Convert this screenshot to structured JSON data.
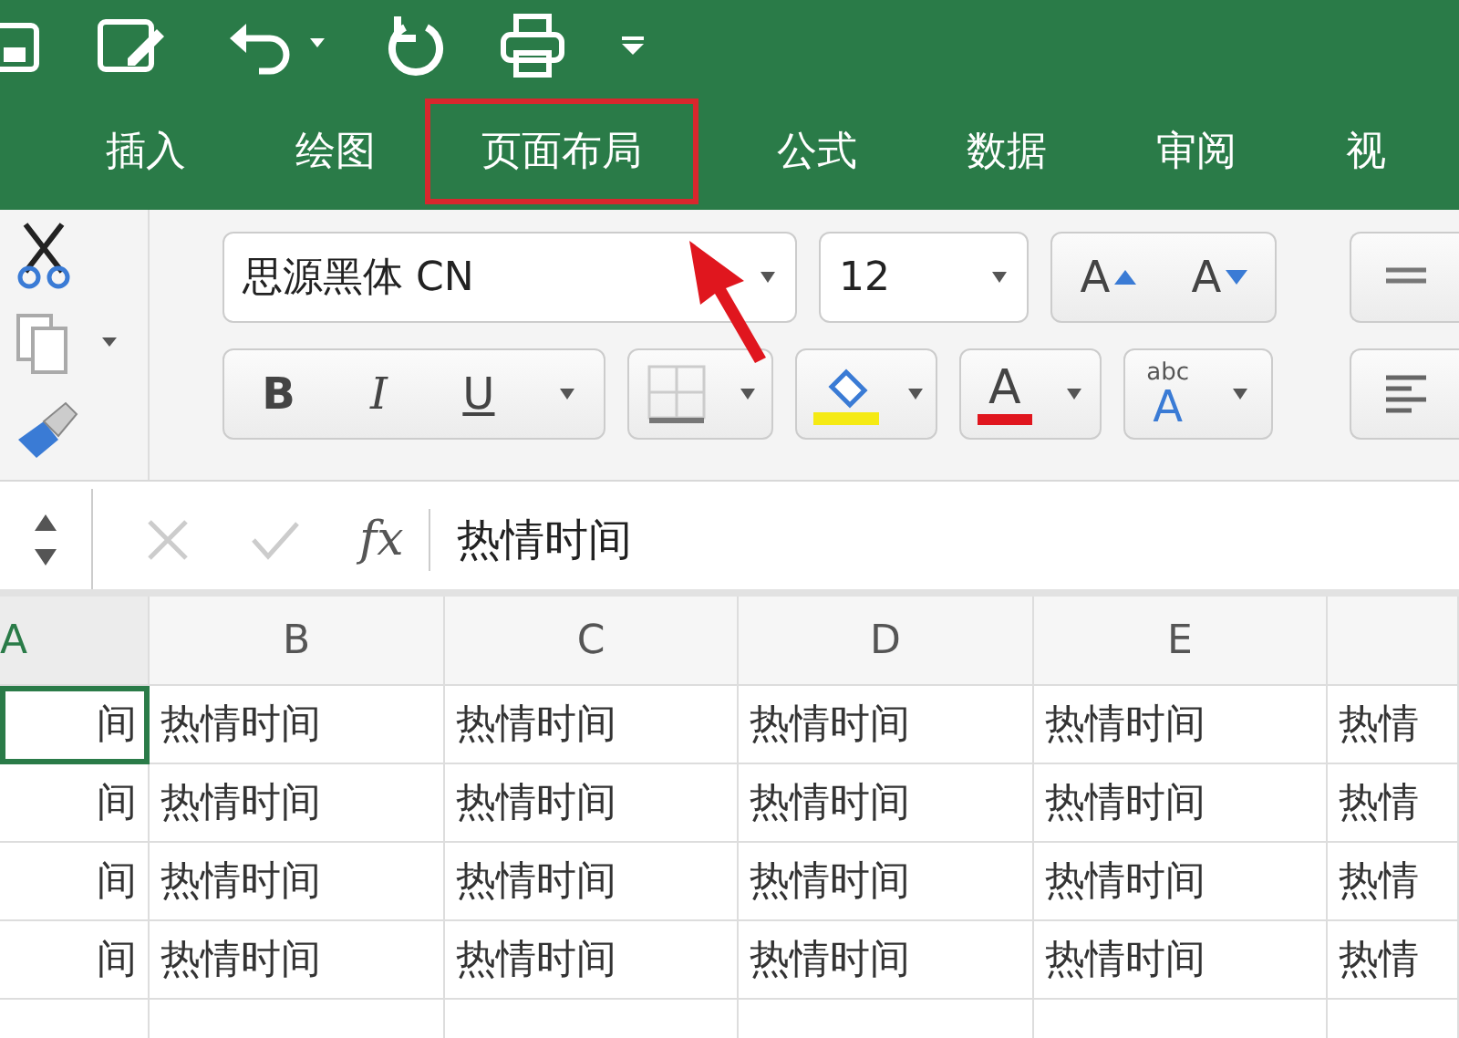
{
  "ribbon_tabs": [
    {
      "label": "插入",
      "highlighted": false
    },
    {
      "label": "绘图",
      "highlighted": false
    },
    {
      "label": "页面布局",
      "highlighted": true
    },
    {
      "label": "公式",
      "highlighted": false
    },
    {
      "label": "数据",
      "highlighted": false
    },
    {
      "label": "审阅",
      "highlighted": false
    },
    {
      "label": "视",
      "highlighted": false
    }
  ],
  "font": {
    "name": "思源黑体 CN",
    "size": "12",
    "grow": "A",
    "shrink": "A",
    "bold": "B",
    "italic": "I",
    "underline": "U",
    "font_color": "A",
    "phonetic_small": "abc",
    "phonetic_big": "A"
  },
  "formula_bar": {
    "fx": "fx",
    "content": "热情时间"
  },
  "sheet": {
    "columns": [
      "A",
      "B",
      "C",
      "D",
      "E"
    ],
    "rows": [
      [
        {
          "text": "间",
          "selected": true
        },
        {
          "text": "热情时间",
          "selected": false
        },
        {
          "text": "热情时间",
          "selected": false
        },
        {
          "text": "热情时间",
          "selected": false
        },
        {
          "text": "热情时间",
          "selected": false
        },
        {
          "text": "热情",
          "selected": false
        }
      ],
      [
        {
          "text": "间",
          "selected": false
        },
        {
          "text": "热情时间",
          "selected": false
        },
        {
          "text": "热情时间",
          "selected": false
        },
        {
          "text": "热情时间",
          "selected": false
        },
        {
          "text": "热情时间",
          "selected": false
        },
        {
          "text": "热情",
          "selected": false
        }
      ],
      [
        {
          "text": "间",
          "selected": false
        },
        {
          "text": "热情时间",
          "selected": false
        },
        {
          "text": "热情时间",
          "selected": false
        },
        {
          "text": "热情时间",
          "selected": false
        },
        {
          "text": "热情时间",
          "selected": false
        },
        {
          "text": "热情",
          "selected": false
        }
      ],
      [
        {
          "text": "间",
          "selected": false
        },
        {
          "text": "热情时间",
          "selected": false
        },
        {
          "text": "热情时间",
          "selected": false
        },
        {
          "text": "热情时间",
          "selected": false
        },
        {
          "text": "热情时间",
          "selected": false
        },
        {
          "text": "热情",
          "selected": false
        }
      ]
    ]
  }
}
